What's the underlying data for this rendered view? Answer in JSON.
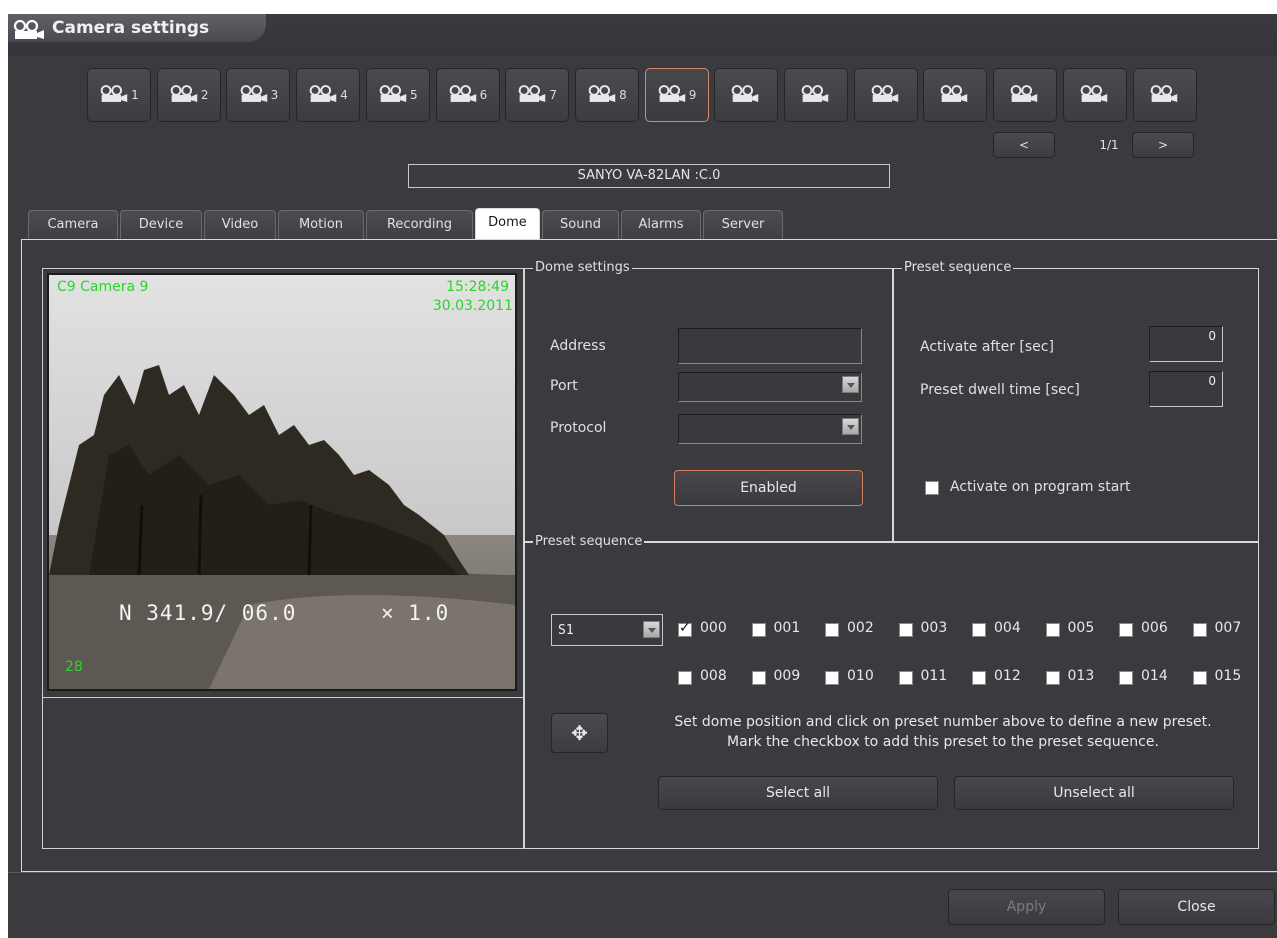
{
  "window": {
    "title": "Camera settings"
  },
  "cameras": [
    {
      "num": "1"
    },
    {
      "num": "2"
    },
    {
      "num": "3"
    },
    {
      "num": "4"
    },
    {
      "num": "5"
    },
    {
      "num": "6"
    },
    {
      "num": "7"
    },
    {
      "num": "8"
    },
    {
      "num": "9",
      "active": true
    },
    {
      "num": ""
    },
    {
      "num": ""
    },
    {
      "num": ""
    },
    {
      "num": ""
    },
    {
      "num": ""
    },
    {
      "num": ""
    },
    {
      "num": ""
    }
  ],
  "pager": {
    "prev": "<",
    "page": "1/1",
    "next": ">"
  },
  "device_name": "SANYO VA-82LAN :C.0",
  "tabs": [
    "Camera",
    "Device",
    "Video",
    "Motion",
    "Recording",
    "Dome",
    "Sound",
    "Alarms",
    "Server"
  ],
  "active_tab": "Dome",
  "video": {
    "camera_label": "C9 Camera 9",
    "time": "15:28:49",
    "date": "30.03.2011",
    "position": "N 341.9/ 06.0",
    "zoom": "× 1.0",
    "frame_number": "28"
  },
  "dome_settings": {
    "legend": "Dome settings",
    "address_label": "Address",
    "port_label": "Port",
    "protocol_label": "Protocol",
    "address_value": "",
    "port_value": "",
    "protocol_value": "",
    "enabled_button": "Enabled"
  },
  "preset_timing": {
    "legend": "Preset sequence",
    "activate_after_label": "Activate after [sec]",
    "activate_after_value": "0",
    "dwell_label": "Preset dwell time [sec]",
    "dwell_value": "0",
    "activate_on_start_label": "Activate on program start",
    "activate_on_start_checked": false
  },
  "preset_sequence": {
    "legend": "Preset sequence",
    "sequence_select": "S1",
    "presets": [
      {
        "num": "000",
        "checked": true
      },
      {
        "num": "001",
        "checked": false
      },
      {
        "num": "002",
        "checked": false
      },
      {
        "num": "003",
        "checked": false
      },
      {
        "num": "004",
        "checked": false
      },
      {
        "num": "005",
        "checked": false
      },
      {
        "num": "006",
        "checked": false
      },
      {
        "num": "007",
        "checked": false
      },
      {
        "num": "008",
        "checked": false
      },
      {
        "num": "009",
        "checked": false
      },
      {
        "num": "010",
        "checked": false
      },
      {
        "num": "011",
        "checked": false
      },
      {
        "num": "012",
        "checked": false
      },
      {
        "num": "013",
        "checked": false
      },
      {
        "num": "014",
        "checked": false
      },
      {
        "num": "015",
        "checked": false
      }
    ],
    "info_line1": "Set dome position and click on preset number above to define a new preset.",
    "info_line2": "Mark the checkbox to add this preset to the preset sequence.",
    "select_all": "Select all",
    "unselect_all": "Unselect all"
  },
  "footer": {
    "apply": "Apply",
    "close": "Close"
  },
  "colors": {
    "background": "#3b3b3f",
    "accent_border": "#d47f5c",
    "osd_text": "#2bd42b"
  }
}
